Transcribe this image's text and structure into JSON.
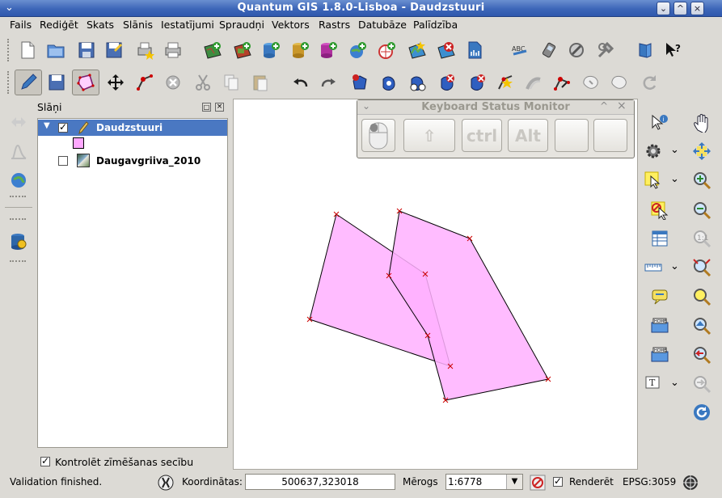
{
  "window": {
    "title": "Quantum GIS 1.8.0-Lisboa - Daudzstuuri"
  },
  "menu": [
    "Fails",
    "Rediģēt",
    "Skats",
    "Slānis",
    "Iestatījumi",
    "Spraudņi",
    "Vektors",
    "Rastrs",
    "Datubāze",
    "Palīdzība"
  ],
  "toolbar1": [
    "new-project-icon",
    "open-project-icon",
    "save-project-icon",
    "save-as-icon",
    "print-composer-icon",
    "print-icon",
    "add-vector-icon",
    "add-raster-icon",
    "add-postgis-icon",
    "add-spatialite-icon",
    "add-mssql-icon",
    "add-wms-icon",
    "add-wfs-icon",
    "new-shapefile-icon",
    "remove-layer-icon",
    "add-delimited-text-icon",
    "spell-check-icon",
    "gps-icon",
    "plugin-icon",
    "settings-icon",
    "help-book-icon",
    "whats-this-icon"
  ],
  "toolbar2": [
    "toggle-editing-icon",
    "save-edits-icon",
    "capture-polygon-icon",
    "move-feature-icon",
    "node-tool-icon",
    "delete-selected-icon",
    "cut-icon",
    "copy-icon",
    "paste-icon",
    "undo-icon",
    "redo-icon",
    "add-ring-icon",
    "add-part-icon",
    "delete-ring-icon",
    "delete-part-icon",
    "reshape-icon",
    "offset-curve-icon",
    "split-features-icon",
    "merge-features-icon",
    "merge-attributes-icon",
    "rotate-icon"
  ],
  "layers_panel": {
    "title": "Slāņi",
    "layers": [
      {
        "name": "Daudzstuuri",
        "checked": true,
        "selected": true,
        "fill": "#ffa8ff"
      },
      {
        "name": "Daugavgriiva_2010",
        "checked": false,
        "selected": false
      }
    ],
    "render_order_label": "Kontrolēt zīmēšanas secību",
    "render_order_checked": true
  },
  "keyboard_monitor": {
    "title": "Keyboard Status Monitor",
    "keys": [
      "mouse",
      "shift",
      "ctrl",
      "Alt",
      "",
      ""
    ]
  },
  "status": {
    "message": "Validation finished.",
    "coords_label": "Koordinātas:",
    "coords_value": "500637,323018",
    "scale_label": "Mērogs",
    "scale_value": "1:6778",
    "render_label": "Renderēt",
    "render_checked": true,
    "crs": "EPSG:3059"
  },
  "map_colors": {
    "fill": "#ffb0ff",
    "stroke": "#000000",
    "vertex": "#cc0000"
  }
}
